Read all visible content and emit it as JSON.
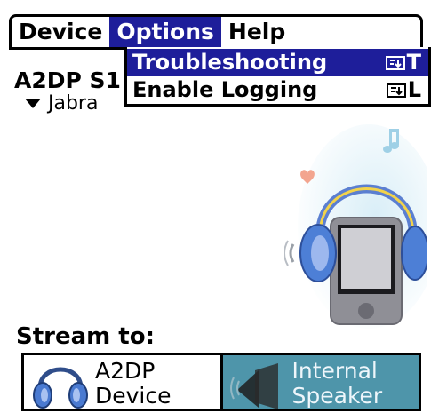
{
  "menubar": {
    "items": [
      {
        "label": "Device"
      },
      {
        "label": "Options"
      },
      {
        "label": "Help"
      }
    ],
    "active": "Options"
  },
  "dropdown": {
    "items": [
      {
        "label": "Troubleshooting",
        "shortcut": "T"
      },
      {
        "label": "Enable Logging",
        "shortcut": "L"
      }
    ]
  },
  "main": {
    "app_label": "A2DP S1",
    "device_selected": "Jabra",
    "stream_label": "Stream to:"
  },
  "stream_options": [
    {
      "line1": "A2DP",
      "line2": "Device",
      "icon": "headphones-icon",
      "selected": false
    },
    {
      "line1": "Internal",
      "line2": "Speaker",
      "icon": "speaker-icon",
      "selected": true
    }
  ],
  "colors": {
    "menu_highlight": "#1e1e9a",
    "selected_segment": "#4e95aa"
  }
}
